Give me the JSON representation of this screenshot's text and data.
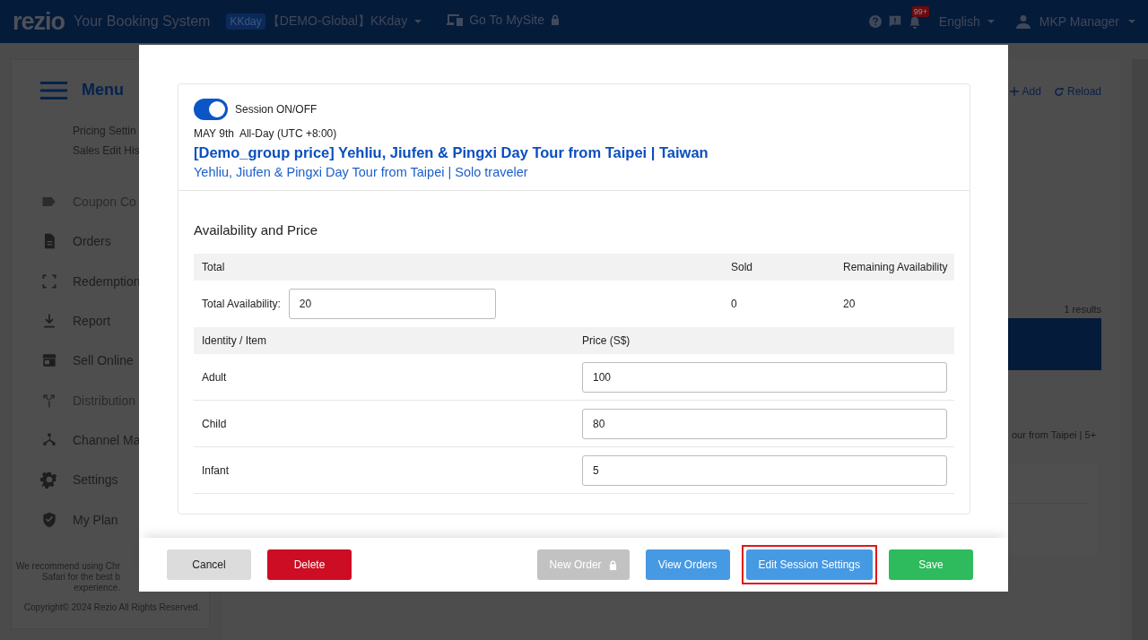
{
  "header": {
    "logo": "rezio",
    "tagline": "Your Booking System",
    "org_badge": "KKday",
    "org_name": "【DEMO-Global】KKday",
    "mysite": "Go To MySite",
    "notifications": "99+",
    "language": "English",
    "user": "MKP Manager"
  },
  "sidebar": {
    "title": "Menu",
    "items": [
      {
        "label": "Pricing Settin",
        "kind": "sub",
        "disabled": false
      },
      {
        "label": "Sales Edit His",
        "kind": "sub",
        "disabled": false
      },
      {
        "label": "Coupon Co",
        "kind": "main",
        "disabled": true
      },
      {
        "label": "Orders",
        "kind": "main",
        "disabled": false
      },
      {
        "label": "Redemption",
        "kind": "main",
        "disabled": false
      },
      {
        "label": "Report",
        "kind": "main",
        "disabled": false
      },
      {
        "label": "Sell Online",
        "kind": "main",
        "disabled": false
      },
      {
        "label": "Distribution",
        "kind": "main",
        "disabled": true
      },
      {
        "label": "Channel Ma",
        "kind": "main",
        "disabled": false
      },
      {
        "label": "Settings",
        "kind": "main",
        "disabled": false
      },
      {
        "label": "My Plan",
        "kind": "main",
        "disabled": false
      }
    ],
    "notice": [
      "We recommend using Chr",
      "Safari for the best b",
      "experience."
    ],
    "copyright": "Copyright© 2024 Rezio All Rights Reserved."
  },
  "main": {
    "add": "Add",
    "reload": "Reload",
    "results": "1 results",
    "row_text": "our from Taipei | 5+"
  },
  "modal": {
    "session": {
      "on": true,
      "label": "Session ON/OFF"
    },
    "date": "MAY 9th  All-Day (UTC +8:00)",
    "title": "[Demo_group price] Yehliu, Jiufen & Pingxi Day Tour from Taipei | Taiwan",
    "subtitle": "Yehliu, Jiufen & Pingxi Day Tour from Taipei | Solo traveler",
    "section": "Availability and Price",
    "total_columns": [
      "Total",
      "Sold",
      "Remaining Availability"
    ],
    "total_row": {
      "label": "Total Availability:",
      "value": "20",
      "sold": "0",
      "remaining": "20"
    },
    "price_columns": [
      "Identity / Item",
      "Price (S$)"
    ],
    "items": [
      {
        "name": "Adult",
        "price": "100"
      },
      {
        "name": "Child",
        "price": "80"
      },
      {
        "name": "Infant",
        "price": "5"
      }
    ],
    "buttons": [
      {
        "label": "Cancel",
        "kind": "neutral",
        "disabled": false,
        "locked": false,
        "highlighted": false
      },
      {
        "label": "Delete",
        "kind": "danger",
        "disabled": false,
        "locked": false,
        "highlighted": false
      },
      {
        "label": "New Order",
        "kind": "neutral",
        "disabled": true,
        "locked": true,
        "highlighted": false
      },
      {
        "label": "View Orders",
        "kind": "info",
        "disabled": false,
        "locked": false,
        "highlighted": false
      },
      {
        "label": "Edit Session Settings",
        "kind": "info",
        "disabled": false,
        "locked": false,
        "highlighted": true
      },
      {
        "label": "Save",
        "kind": "success",
        "disabled": false,
        "locked": false,
        "highlighted": false
      }
    ]
  }
}
